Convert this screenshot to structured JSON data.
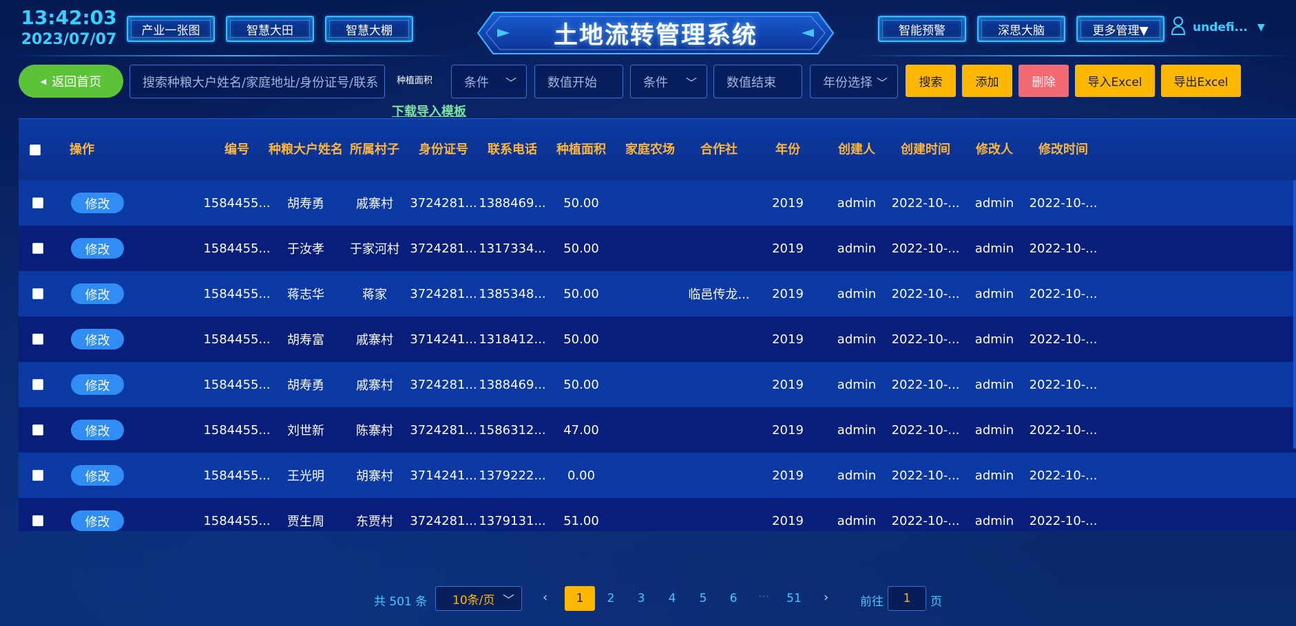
{
  "header": {
    "time": "13:42:03",
    "date": "2023/07/07",
    "title": "土地流转管理系统",
    "left_nav": [
      "产业一张图",
      "智慧大田",
      "智慧大棚"
    ],
    "right_nav": [
      "智能预警",
      "深思大脑",
      "更多管理▼"
    ],
    "user_name": "undefi...",
    "user_caret": "▼"
  },
  "toolbar": {
    "back_label": "返回首页",
    "back_icon": "◀",
    "search_placeholder": "搜索种粮大户姓名/家庭地址/身份证号/联系",
    "area_label": "种植面积",
    "condition1": "条件",
    "value_start": "数值开始",
    "condition2": "条件",
    "value_end": "数值结束",
    "year_select": "年份选择",
    "chevron": "﹀",
    "search_btn": "搜索",
    "add_btn": "添加",
    "delete_btn": "删除",
    "import_btn": "导入Excel",
    "export_btn": "导出Excel",
    "template_link": "下载导入模板"
  },
  "table": {
    "headers": [
      "操作",
      "编号",
      "种粮大户姓名",
      "所属村子",
      "身份证号",
      "联系电话",
      "种植面积",
      "家庭农场",
      "合作社",
      "年份",
      "创建人",
      "创建时间",
      "修改人",
      "修改时间"
    ],
    "edit_label": "修改",
    "rows": [
      [
        "1584455...",
        "胡寿勇",
        "戚寨村",
        "3724281...",
        "1388469...",
        "50.00",
        "",
        "",
        "2019",
        "admin",
        "2022-10-...",
        "admin",
        "2022-10-..."
      ],
      [
        "1584455...",
        "于汝孝",
        "于家河村",
        "3724281...",
        "1317334...",
        "50.00",
        "",
        "",
        "2019",
        "admin",
        "2022-10-...",
        "admin",
        "2022-10-..."
      ],
      [
        "1584455...",
        "蒋志华",
        "蒋家",
        "3724281...",
        "1385348...",
        "50.00",
        "",
        "临邑传龙...",
        "2019",
        "admin",
        "2022-10-...",
        "admin",
        "2022-10-..."
      ],
      [
        "1584455...",
        "胡寿富",
        "戚寨村",
        "3714241...",
        "1318412...",
        "50.00",
        "",
        "",
        "2019",
        "admin",
        "2022-10-...",
        "admin",
        "2022-10-..."
      ],
      [
        "1584455...",
        "胡寿勇",
        "戚寨村",
        "3724281...",
        "1388469...",
        "50.00",
        "",
        "",
        "2019",
        "admin",
        "2022-10-...",
        "admin",
        "2022-10-..."
      ],
      [
        "1584455...",
        "刘世新",
        "陈寨村",
        "3724281...",
        "1586312...",
        "47.00",
        "",
        "",
        "2019",
        "admin",
        "2022-10-...",
        "admin",
        "2022-10-..."
      ],
      [
        "1584455...",
        "王光明",
        "胡寨村",
        "3714241...",
        "1379222...",
        "0.00",
        "",
        "",
        "2019",
        "admin",
        "2022-10-...",
        "admin",
        "2022-10-..."
      ],
      [
        "1584455...",
        "贾生周",
        "东贾村",
        "3724281...",
        "1379131...",
        "51.00",
        "",
        "",
        "2019",
        "admin",
        "2022-10-...",
        "admin",
        "2022-10-..."
      ]
    ]
  },
  "pagination": {
    "total": "共 501 条",
    "page_size": "10条/页",
    "prev": "‹",
    "next": "›",
    "pages": [
      "1",
      "2",
      "3",
      "4",
      "5",
      "6",
      "51"
    ],
    "ellipsis": "···",
    "current": "1",
    "goto_label": "前往",
    "goto_value": "1",
    "goto_unit": "页"
  }
}
